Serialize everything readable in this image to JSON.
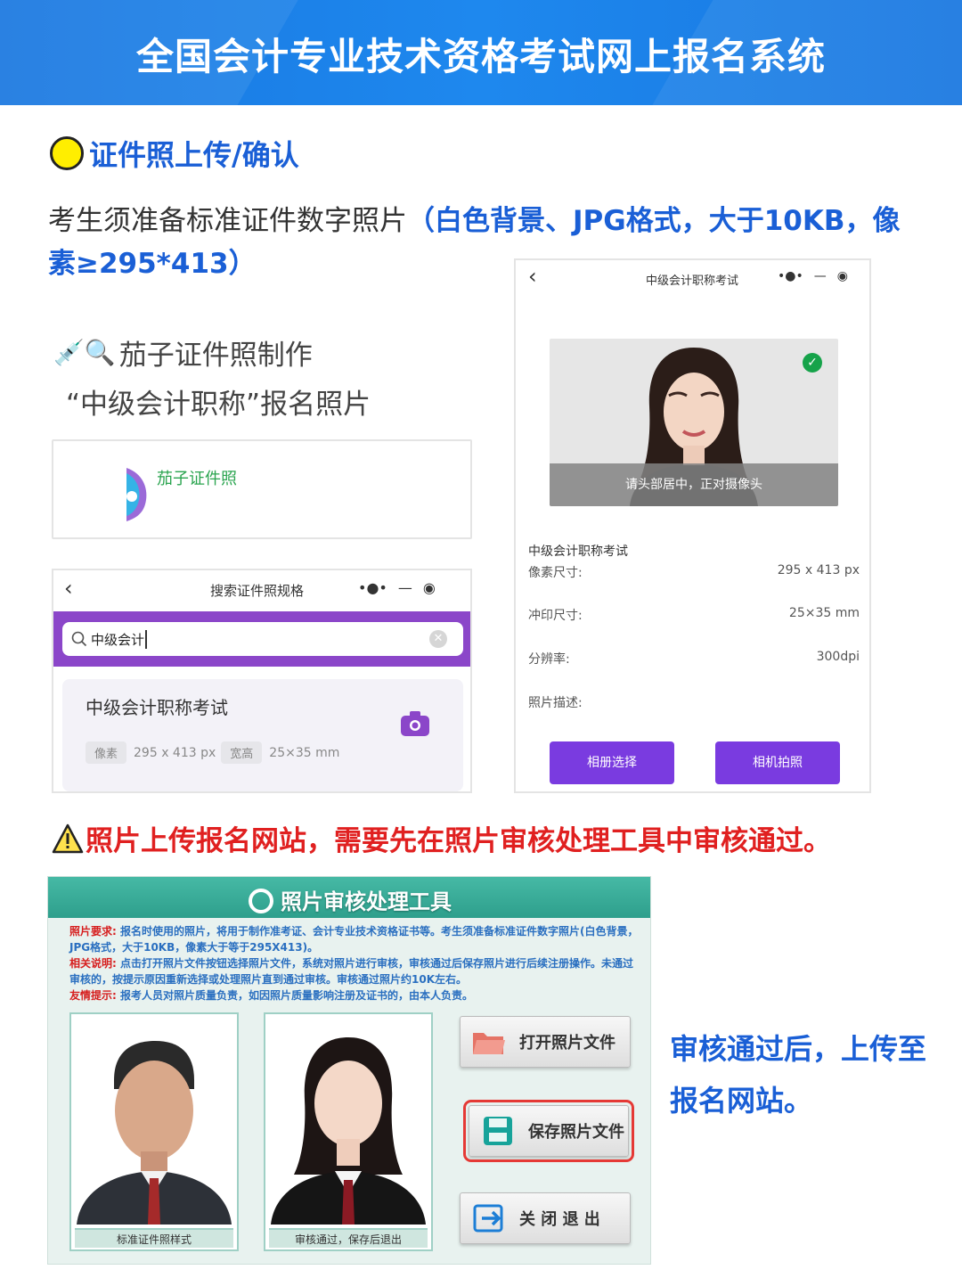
{
  "banner": {
    "title": "全国会计专业技术资格考试网上报名系统"
  },
  "section": {
    "title": "证件照上传/确认"
  },
  "intro": {
    "text": "考生须准备标准证件数字照片",
    "highlight": "（白色背景、JPG格式，大于10KB，像素≥295*413）"
  },
  "app": {
    "line1_icons": "💉🔍",
    "line1": "茄子证件照制作",
    "line2": "“中级会计职称”报名照片",
    "name": "茄子证件照"
  },
  "search_screen": {
    "title": "搜索证件照规格",
    "query": "中级会计",
    "result_title": "中级会计职称考试",
    "chip_pixel": "像素",
    "pixel_value": "295 x 413 px",
    "chip_size": "宽高",
    "size_value": "25×35 mm"
  },
  "camera_screen": {
    "title": "中级会计职称考试",
    "overlay_hint": "请头部居中，正对摄像头",
    "spec_title": "中级会计职称考试",
    "rows": [
      {
        "label": "像素尺寸:",
        "value": "295 x 413 px"
      },
      {
        "label": "冲印尺寸:",
        "value": "25×35 mm"
      },
      {
        "label": "分辨率:",
        "value": "300dpi"
      },
      {
        "label": "照片描述:",
        "value": ""
      }
    ],
    "btn_album": "相册选择",
    "btn_camera": "相机拍照"
  },
  "warning": {
    "text": "照片上传报名网站，需要先在照片审核处理工具中审核通过。"
  },
  "tool": {
    "title": "照片审核处理工具",
    "req_label": "照片要求:",
    "req_text": "报名时使用的照片，将用于制作准考证、会计专业技术资格证书等。考生须准备标准证件数字照片(白色背景，JPG格式，大于10KB，像素大于等于295X413)。",
    "desc_label": "相关说明:",
    "desc_text": "点击打开照片文件按钮选择照片文件，系统对照片进行审核，审核通过后保存照片进行后续注册操作。未通过审核的，按提示原因重新选择或处理照片直到通过审核。审核通过照片约10K左右。",
    "tip_label": "友情提示:",
    "tip_text": "报考人员对照片质量负责，如因照片质量影响注册及证书的，由本人负责。",
    "caption_left": "标准证件照样式",
    "caption_right": "审核通过，保存后退出",
    "btn_open": "打开照片文件",
    "btn_save": "保存照片文件",
    "btn_close": "关 闭 退 出"
  },
  "side_note": {
    "line1": "审核通过后，上传至",
    "line2": "报名网站。"
  }
}
